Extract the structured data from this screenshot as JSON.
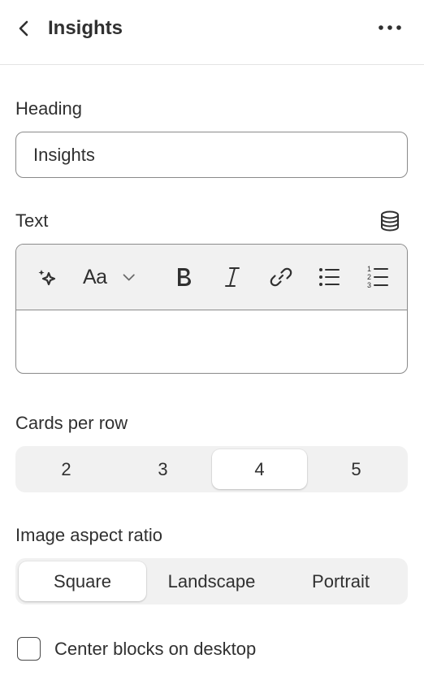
{
  "header": {
    "title": "Insights",
    "back_icon": "chevron-left-icon",
    "more_icon": "more-horizontal-icon"
  },
  "heading_field": {
    "label": "Heading",
    "value": "Insights"
  },
  "text_field": {
    "label": "Text",
    "source_icon": "database-icon",
    "value": "",
    "toolbar": [
      "magic-sparkle-icon",
      "text-style-icon",
      "chevron-down-icon",
      "bold-icon",
      "italic-icon",
      "link-icon",
      "bullet-list-icon",
      "numbered-list-icon"
    ],
    "text_style_glyph": "Aa"
  },
  "cards_per_row": {
    "label": "Cards per row",
    "options": [
      "2",
      "3",
      "4",
      "5"
    ],
    "selected": "4"
  },
  "aspect_ratio": {
    "label": "Image aspect ratio",
    "options": [
      "Square",
      "Landscape",
      "Portrait"
    ],
    "selected": "Square"
  },
  "center_blocks": {
    "label": "Center blocks on desktop",
    "checked": false
  },
  "colors": {
    "text": "#303030",
    "border": "#8a8a8a",
    "segment_bg": "#f1f1f1",
    "active_bg": "#ffffff"
  }
}
